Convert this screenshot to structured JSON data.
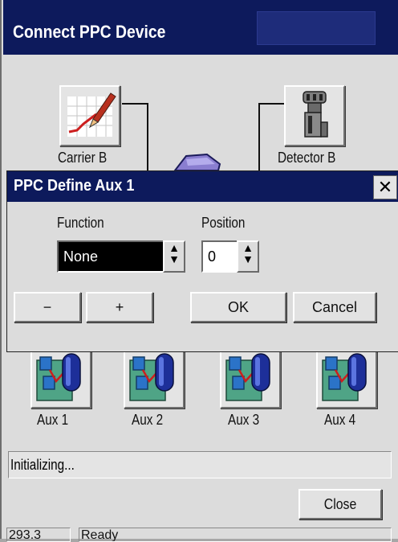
{
  "window": {
    "title": "Connect PPC Device"
  },
  "devices_top": [
    {
      "label": "Carrier B",
      "icon": "carrier-chart-icon"
    },
    {
      "label": "Detector B",
      "icon": "detector-icon"
    }
  ],
  "dialog": {
    "title": "PPC Define Aux 1",
    "close_glyph": "✕",
    "function_label": "Function",
    "function_value": "None",
    "position_label": "Position",
    "position_value": "0",
    "minus_label": "−",
    "plus_label": "+",
    "ok_label": "OK",
    "cancel_label": "Cancel"
  },
  "aux_devices": [
    {
      "label": "Aux 1"
    },
    {
      "label": "Aux 2"
    },
    {
      "label": "Aux 3"
    },
    {
      "label": "Aux 4"
    }
  ],
  "status_text": "Initializing...",
  "close_label": "Close",
  "statusbar": {
    "cell1": "293.3",
    "cell2": "Ready"
  }
}
